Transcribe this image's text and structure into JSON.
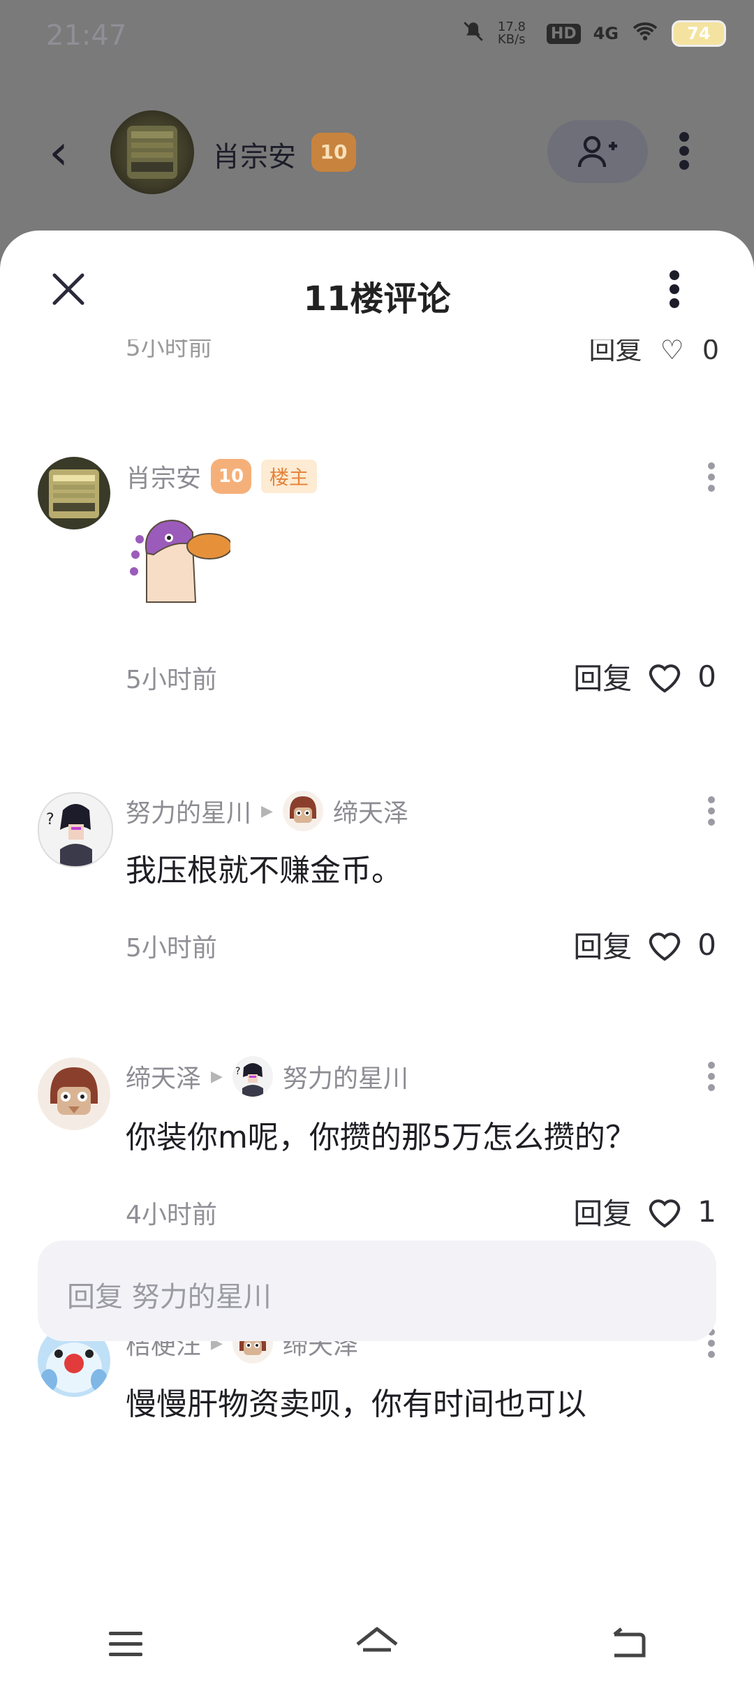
{
  "status": {
    "time": "21:47",
    "speed": "17.8 KB/s",
    "network": "4G",
    "hd": "HD",
    "battery": "74"
  },
  "header": {
    "name": "肖宗安",
    "level": "10"
  },
  "sheet": {
    "title": "11楼评论",
    "partial_time": "5小时前",
    "partial_reply": "回复",
    "partial_likes": "0"
  },
  "comments": [
    {
      "author": "肖宗安",
      "level": "10",
      "tag": "楼主",
      "time": "5小时前",
      "reply": "回复",
      "likes": "0"
    },
    {
      "author": "努力的星川",
      "reply_to": "缔天泽",
      "text": "我压根就不赚金币。",
      "time": "5小时前",
      "reply": "回复",
      "likes": "0"
    },
    {
      "author": "缔天泽",
      "reply_to": "努力的星川",
      "text": "你装你m呢，你攒的那5万怎么攒的？",
      "time": "4小时前",
      "reply": "回复",
      "likes": "1"
    },
    {
      "author": "桔梗汪",
      "reply_to": "缔天泽",
      "text": "慢慢肝物资卖呗，你有时间也可以"
    }
  ],
  "input": {
    "placeholder": "回复 努力的星川"
  },
  "nav": {
    "menu_icon": "menu-icon",
    "home_icon": "home-icon",
    "back_icon": "back-icon"
  },
  "colors": {
    "accent_orange": "#e6843a",
    "sheet_bg": "#ffffff",
    "dim_bg": "#7a7a7a"
  }
}
